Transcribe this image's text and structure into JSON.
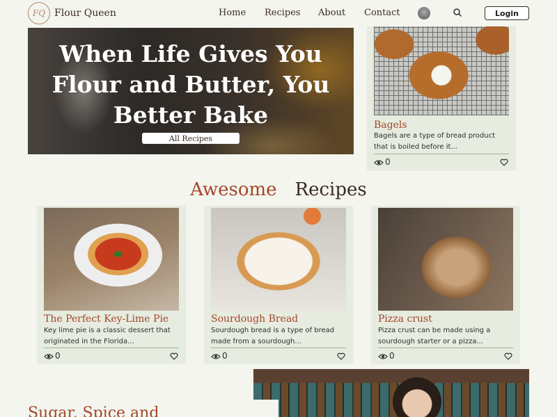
{
  "nav": {
    "logo_text": "FQ",
    "brand": "Flour Queen",
    "links": [
      "Home",
      "Recipes",
      "About",
      "Contact"
    ],
    "login_label": "Login"
  },
  "hero": {
    "title": "When Life Gives You Flour and Butter, You Better Bake",
    "button_label": "All Recipes"
  },
  "featured": {
    "title": "Bagels",
    "description": "Bagels are a type of bread product that is boiled before it...",
    "views": "0"
  },
  "section": {
    "title_part1": "Awesome",
    "title_part2": "Recipes"
  },
  "recipes": [
    {
      "title": "The Perfect Key-Lime Pie",
      "description": "Key lime pie is a classic dessert that originated in the Florida...",
      "views": "0"
    },
    {
      "title": "Sourdough Bread",
      "description": "Sourdough bread is a type of bread made from a sourdough...",
      "views": "0"
    },
    {
      "title": "Pizza crust",
      "description": "Pizza crust can be made using a sourdough starter or a pizza...",
      "views": "0"
    }
  ],
  "bottom": {
    "heading": "Sugar, Spice and"
  },
  "colors": {
    "background": "#f3f5ee",
    "card": "#e6ecdf",
    "accent": "#a4462a",
    "text": "#3a2a22"
  },
  "icons": [
    "logo-icon",
    "avatar",
    "search-icon",
    "eye-icon",
    "heart-icon"
  ]
}
